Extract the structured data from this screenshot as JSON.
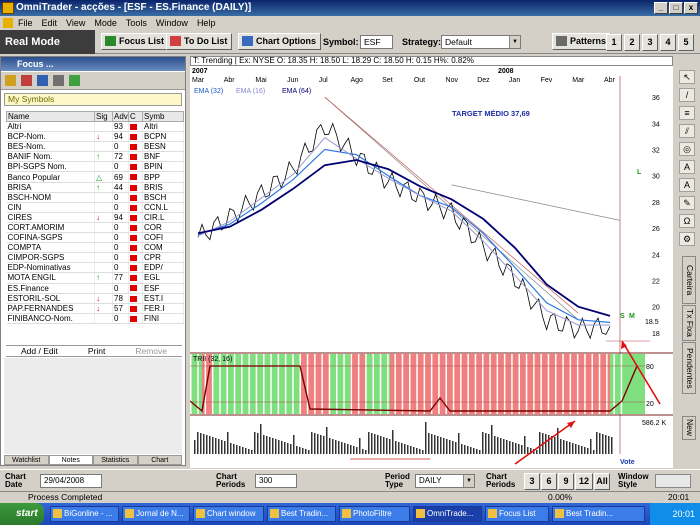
{
  "window": {
    "title": "OmniTrader - acções - [ESF - ES.Finance (DAILY)]"
  },
  "menu": [
    "File",
    "Edit",
    "View",
    "Mode",
    "Tools",
    "Window",
    "Help"
  ],
  "toolbar": {
    "real_mode": "Real Mode",
    "focus_list": "Focus List",
    "todo_list": "To Do List",
    "chart_options": "Chart Options",
    "symbol_label": "Symbol:",
    "symbol_value": "ESF",
    "strategy_label": "Strategy:",
    "strategy_value": "Default",
    "patterns": "Patterns",
    "numbers": [
      "1",
      "2",
      "3",
      "4",
      "5"
    ]
  },
  "focus": {
    "title": "Focus ...",
    "list_name": "My Symbols",
    "columns": [
      "Name",
      "Sig",
      "Adv",
      "C",
      "Symb"
    ],
    "rows": [
      {
        "name": "Altri",
        "sig": "",
        "adv": "93",
        "c": "#e00000",
        "sym": "Altri"
      },
      {
        "name": "BCP-Nom.",
        "sig": "down",
        "adv": "94",
        "c": "#e00000",
        "sym": "BCPN"
      },
      {
        "name": "BES-Nom.",
        "sig": "",
        "adv": "0",
        "c": "#e00000",
        "sym": "BESN"
      },
      {
        "name": "BANIF Nom.",
        "sig": "up",
        "adv": "72",
        "c": "#e00000",
        "sym": "BNF"
      },
      {
        "name": "BPI-SGPS Nom.",
        "sig": "",
        "adv": "0",
        "c": "#e00000",
        "sym": "BPIN"
      },
      {
        "name": "Banco Popular",
        "sig": "tri",
        "adv": "69",
        "c": "#e00000",
        "sym": "BPP"
      },
      {
        "name": "BRISA",
        "sig": "up",
        "adv": "44",
        "c": "#e00000",
        "sym": "BRIS"
      },
      {
        "name": "BSCH-NOM",
        "sig": "",
        "adv": "0",
        "c": "#e00000",
        "sym": "BSCH"
      },
      {
        "name": "CIN",
        "sig": "",
        "adv": "0",
        "c": "#e00000",
        "sym": "CCN.L"
      },
      {
        "name": "CIRES",
        "sig": "down",
        "adv": "94",
        "c": "#e00000",
        "sym": "CIR.L"
      },
      {
        "name": "CORT.AMORIM",
        "sig": "",
        "adv": "0",
        "c": "#e00000",
        "sym": "COR"
      },
      {
        "name": "COFINA-SGPS",
        "sig": "",
        "adv": "0",
        "c": "#e00000",
        "sym": "COFI"
      },
      {
        "name": "COMPTA",
        "sig": "",
        "adv": "0",
        "c": "#e00000",
        "sym": "COM"
      },
      {
        "name": "CIMPOR-SGPS",
        "sig": "",
        "adv": "0",
        "c": "#e00000",
        "sym": "CPR"
      },
      {
        "name": "EDP-Nominativas",
        "sig": "",
        "adv": "0",
        "c": "#e00000",
        "sym": "EDP/"
      },
      {
        "name": "MOTA ENGIL",
        "sig": "up",
        "adv": "77",
        "c": "#e00000",
        "sym": "EGL"
      },
      {
        "name": "ES.Finance",
        "sig": "",
        "adv": "0",
        "c": "#e00000",
        "sym": "ESF"
      },
      {
        "name": "ESTORIL-SOL",
        "sig": "down",
        "adv": "78",
        "c": "#e00000",
        "sym": "EST.I"
      },
      {
        "name": "PAP.FERNANDES",
        "sig": "down",
        "adv": "57",
        "c": "#e00000",
        "sym": "FER.I"
      },
      {
        "name": "FINIBANCO-Nom.",
        "sig": "",
        "adv": "0",
        "c": "#e00000",
        "sym": "FINI"
      }
    ],
    "buttons": [
      "Add / Edit",
      "Print",
      "Remove"
    ],
    "tabs": [
      "Watchlist",
      "Notes",
      "Statistics",
      "Chart"
    ]
  },
  "chart": {
    "header": "T: Trending | Ex: NYSE O: 18.35 H: 18.50 L: 18.29 C: 18.50 H: 0.15 H%: 0.82%",
    "year_left": "2007",
    "year_right": "2008",
    "months": [
      "Mar",
      "Abr",
      "Mai",
      "Jun",
      "Jul",
      "Ago",
      "Set",
      "Out",
      "Nov",
      "Dez",
      "Jan",
      "Fev",
      "Mar",
      "Abr"
    ],
    "ema_labels": [
      "EMA (32)",
      "EMA (16)",
      "EMA (64)"
    ],
    "annotation": "TARGET MÉDIO 37,69",
    "price_ticks": [
      "36",
      "34",
      "32",
      "30",
      "28",
      "26",
      "24",
      "22",
      "20",
      "18"
    ],
    "last_price": "18.5",
    "lower_label": "TRII (32, 16)",
    "lower_ticks": [
      "80",
      "20"
    ],
    "volume_label": "586.2 K",
    "vote": "Vote",
    "signal_s": "S",
    "signal_m": "M",
    "signal_l": "L"
  },
  "chart_data": {
    "type": "line",
    "title": "ES.Finance (DAILY)",
    "x": [
      "Mar",
      "Abr",
      "Mai",
      "Jun",
      "Jul",
      "Ago",
      "Set",
      "Out",
      "Nov",
      "Dez",
      "Jan",
      "Fev",
      "Mar",
      "Abr"
    ],
    "series": [
      {
        "name": "Price",
        "values": [
          25.3,
          26.8,
          28.6,
          30.5,
          33.8,
          31.5,
          29.6,
          28.4,
          27.2,
          24.6,
          22.2,
          19.0,
          18.3,
          18.5
        ]
      },
      {
        "name": "EMA (32)",
        "values": [
          25.5,
          26.3,
          27.9,
          29.7,
          32.0,
          31.6,
          30.0,
          28.5,
          27.6,
          25.6,
          23.0,
          20.3,
          19.0,
          18.8
        ]
      },
      {
        "name": "EMA (16)",
        "values": [
          25.4,
          26.5,
          28.3,
          30.1,
          32.9,
          31.3,
          29.8,
          28.5,
          27.3,
          25.0,
          22.4,
          19.7,
          18.6,
          18.6
        ]
      },
      {
        "name": "EMA (64)",
        "values": [
          25.6,
          26.1,
          27.4,
          29.0,
          30.8,
          31.2,
          30.5,
          29.2,
          28.2,
          26.7,
          24.5,
          21.7,
          20.0,
          19.3
        ]
      }
    ],
    "ylim": [
      17,
      37
    ],
    "trend_line": {
      "from": {
        "x": "Jul",
        "y": 36
      },
      "to": {
        "x": "Mar",
        "y": 19
      }
    }
  },
  "bottom": {
    "chart_date_label": "Chart Date",
    "chart_date": "29/04/2008",
    "chart_periods_label": "Chart Periods",
    "chart_periods": "300",
    "period_type_label": "Period Type",
    "period_type": "DAILY",
    "chart_periods2_label": "Chart Periods",
    "periods": [
      "3",
      "6",
      "9",
      "12",
      "All"
    ],
    "window_style_label": "Window Style"
  },
  "status": {
    "text": "Process Completed",
    "pct": "0.00%",
    "time": "20:01"
  },
  "taskbar": {
    "start": "start",
    "tasks": [
      "BiGonline - ...",
      "Jornal de N...",
      "Chart window",
      "Best Tradin...",
      "PhotoFiltre",
      "OmniTrade...",
      "Focus List",
      "Best Tradin..."
    ],
    "clock": "20:01"
  },
  "right_tabs": [
    "Carteira",
    "Tx Fixa",
    "Pendentes",
    "New"
  ]
}
